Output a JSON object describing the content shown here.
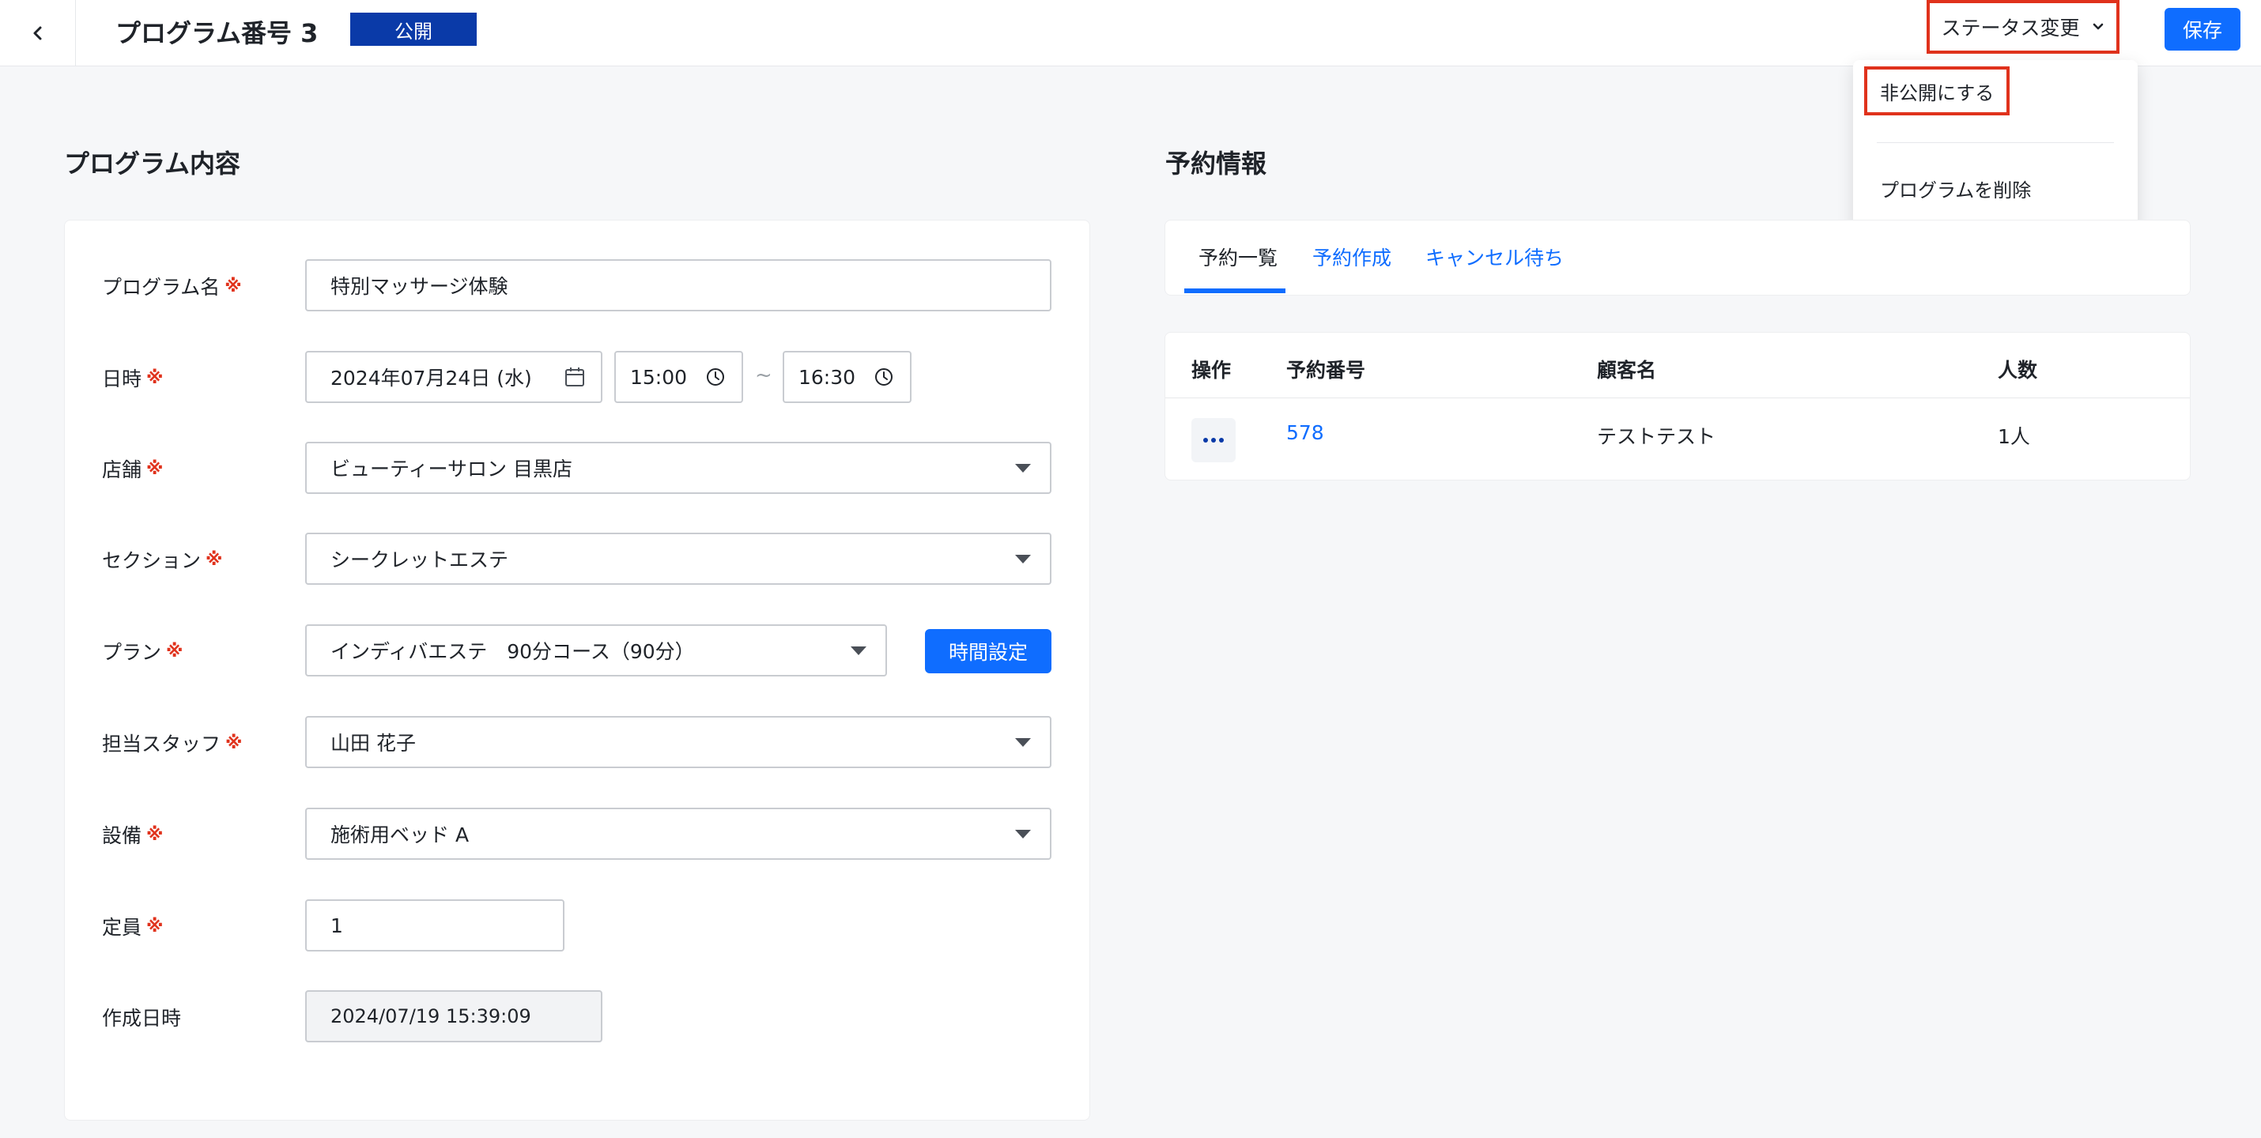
{
  "header": {
    "title": "プログラム番号 3",
    "status_badge": "公開",
    "status_change_label": "ステータス変更",
    "save_label": "保存"
  },
  "status_menu": {
    "items": [
      "非公開にする",
      "プログラムを削除"
    ]
  },
  "program": {
    "section_title": "プログラム内容",
    "required_mark": "※",
    "fields": {
      "name": {
        "label": "プログラム名",
        "value": "特別マッサージ体験"
      },
      "datetime": {
        "label": "日時",
        "date": "2024年07月24日 (水)",
        "start": "15:00",
        "separator": "~",
        "end": "16:30"
      },
      "store": {
        "label": "店舗",
        "value": "ビューティーサロン 目黒店"
      },
      "section": {
        "label": "セクション",
        "value": "シークレットエステ"
      },
      "plan": {
        "label": "プラン",
        "value": "インディバエステ　90分コース（90分）",
        "button": "時間設定"
      },
      "staff": {
        "label": "担当スタッフ",
        "value": "山田 花子"
      },
      "equipment": {
        "label": "設備",
        "value": "施術用ベッド A"
      },
      "capacity": {
        "label": "定員",
        "value": "1"
      },
      "created_at": {
        "label": "作成日時",
        "value": "2024/07/19 15:39:09"
      }
    }
  },
  "reservations": {
    "section_title": "予約情報",
    "tabs": [
      "予約一覧",
      "予約作成",
      "キャンセル待ち"
    ],
    "active_tab": "予約一覧",
    "columns": [
      "操作",
      "予約番号",
      "顧客名",
      "人数"
    ],
    "rows": [
      {
        "number": "578",
        "customer": "テストテスト",
        "people": "1人"
      }
    ]
  },
  "colors": {
    "primary": "#0f6dff",
    "badge": "#0a3aa8",
    "highlight": "#e0321c"
  },
  "icons": [
    "chevron-left-icon",
    "chevron-down-icon",
    "calendar-icon",
    "clock-icon",
    "more-dots-icon"
  ]
}
